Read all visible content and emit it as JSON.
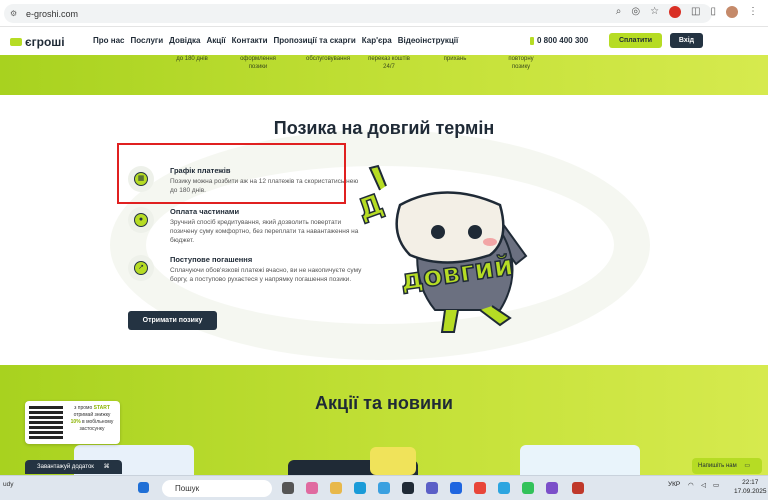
{
  "browser": {
    "url": "e-groshi.com"
  },
  "header": {
    "logo": "єгроші",
    "nav": [
      "Про нас",
      "Послуги",
      "Довідка",
      "Акції",
      "Контакти",
      "Пропозиції та скарги",
      "Кар'єра",
      "Відеоінструкції"
    ],
    "phone": "0 800 400 300",
    "pay_label": "Сплатити",
    "login_label": "Вхід"
  },
  "band": [
    [
      "до 180 днів"
    ],
    [
      "оформлення",
      "позики"
    ],
    [
      "обслуговування"
    ],
    [
      "переказ коштів",
      "24/7"
    ],
    [
      "прихань"
    ],
    [
      "повторну",
      "позику"
    ]
  ],
  "loan": {
    "title": "Позика на довгий термін",
    "features": [
      {
        "title": "Графік платежів",
        "text": "Позику можна розбити аж на 12 платежів та скористатись нею до 180 днів."
      },
      {
        "title": "Оплата частинами",
        "text": "Зручний спосіб кредитування, який дозволить повертати позичену суму комфортно, без переплати та навантаження на бюджет."
      },
      {
        "title": "Поступове погашення",
        "text": "Сплачуючи обов'язкові платежі вчасно, ви не накопичуєте суму боргу, а поступово рухаєтеся у напрямку погашення позики."
      }
    ],
    "cta": "Отримати позику",
    "mascot_text": "довгий"
  },
  "news": {
    "title": "Акції та новини"
  },
  "promo": {
    "line1": "з промо",
    "code": "START",
    "line2": "отримай знижку",
    "discount": "10%",
    "line3": "в мобільному застосунку"
  },
  "download_app": "Завантажуй додаток",
  "chat_label": "Напишіть нам",
  "taskbar": {
    "search": "Пошук",
    "lang": "УКР",
    "time": "22:17",
    "date": "17.09.2025",
    "weather": "udy"
  },
  "colors": {
    "brand_green": "#b6dc24",
    "navy": "#243342",
    "highlight": "#e02020"
  }
}
